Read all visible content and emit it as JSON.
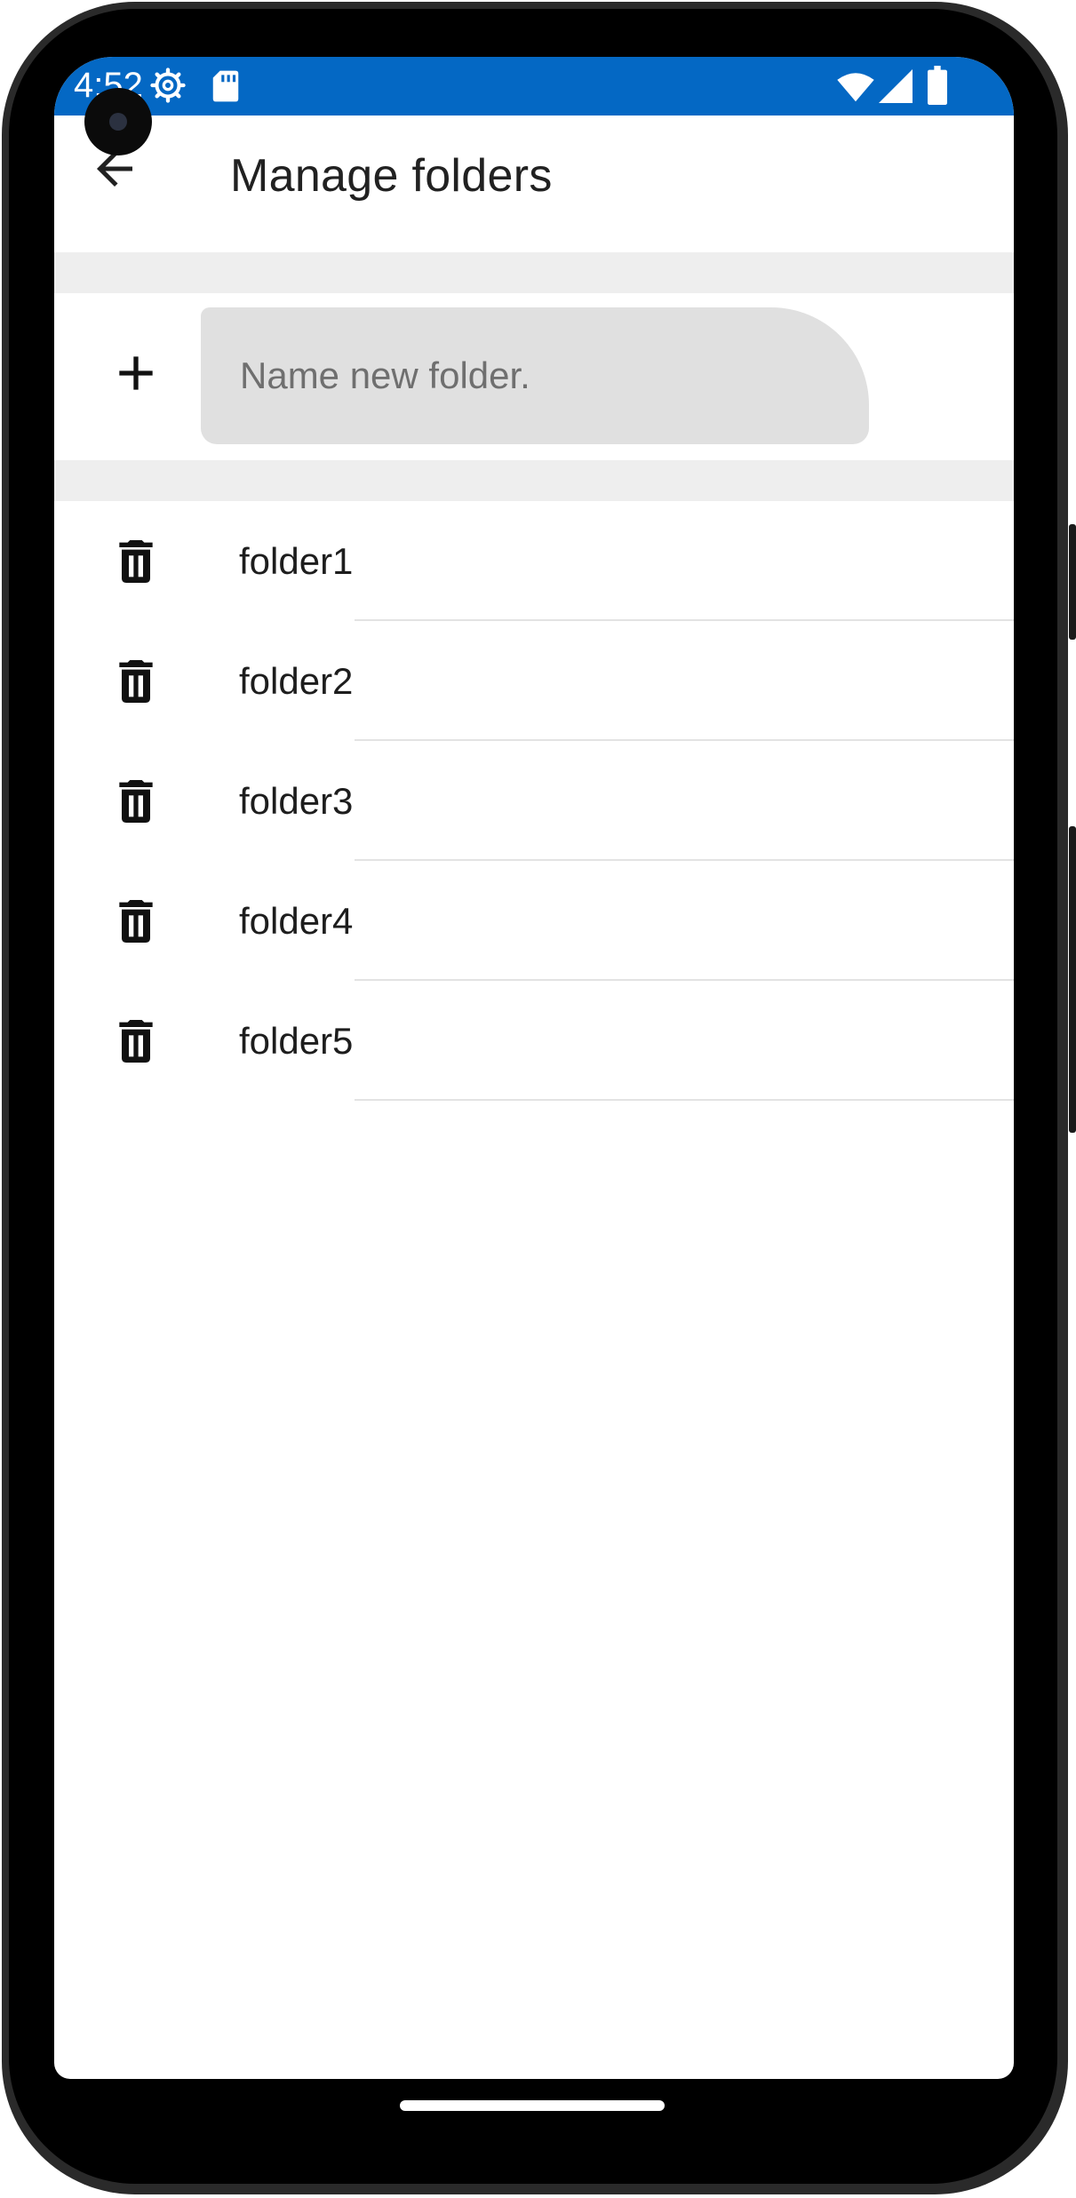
{
  "status_bar": {
    "time": "4:52",
    "icons": [
      "settings-icon",
      "sd-card-icon",
      "wifi-icon",
      "signal-icon",
      "battery-icon"
    ],
    "background_color": "#0468c4"
  },
  "app_bar": {
    "title": "Manage folders",
    "back_icon": "arrow-back-icon"
  },
  "new_folder": {
    "add_icon": "plus-icon",
    "placeholder": "Name new folder.",
    "value": ""
  },
  "folders": {
    "delete_icon": "trash-icon",
    "items": [
      {
        "name": "folder1"
      },
      {
        "name": "folder2"
      },
      {
        "name": "folder3"
      },
      {
        "name": "folder4"
      },
      {
        "name": "folder5"
      }
    ]
  }
}
